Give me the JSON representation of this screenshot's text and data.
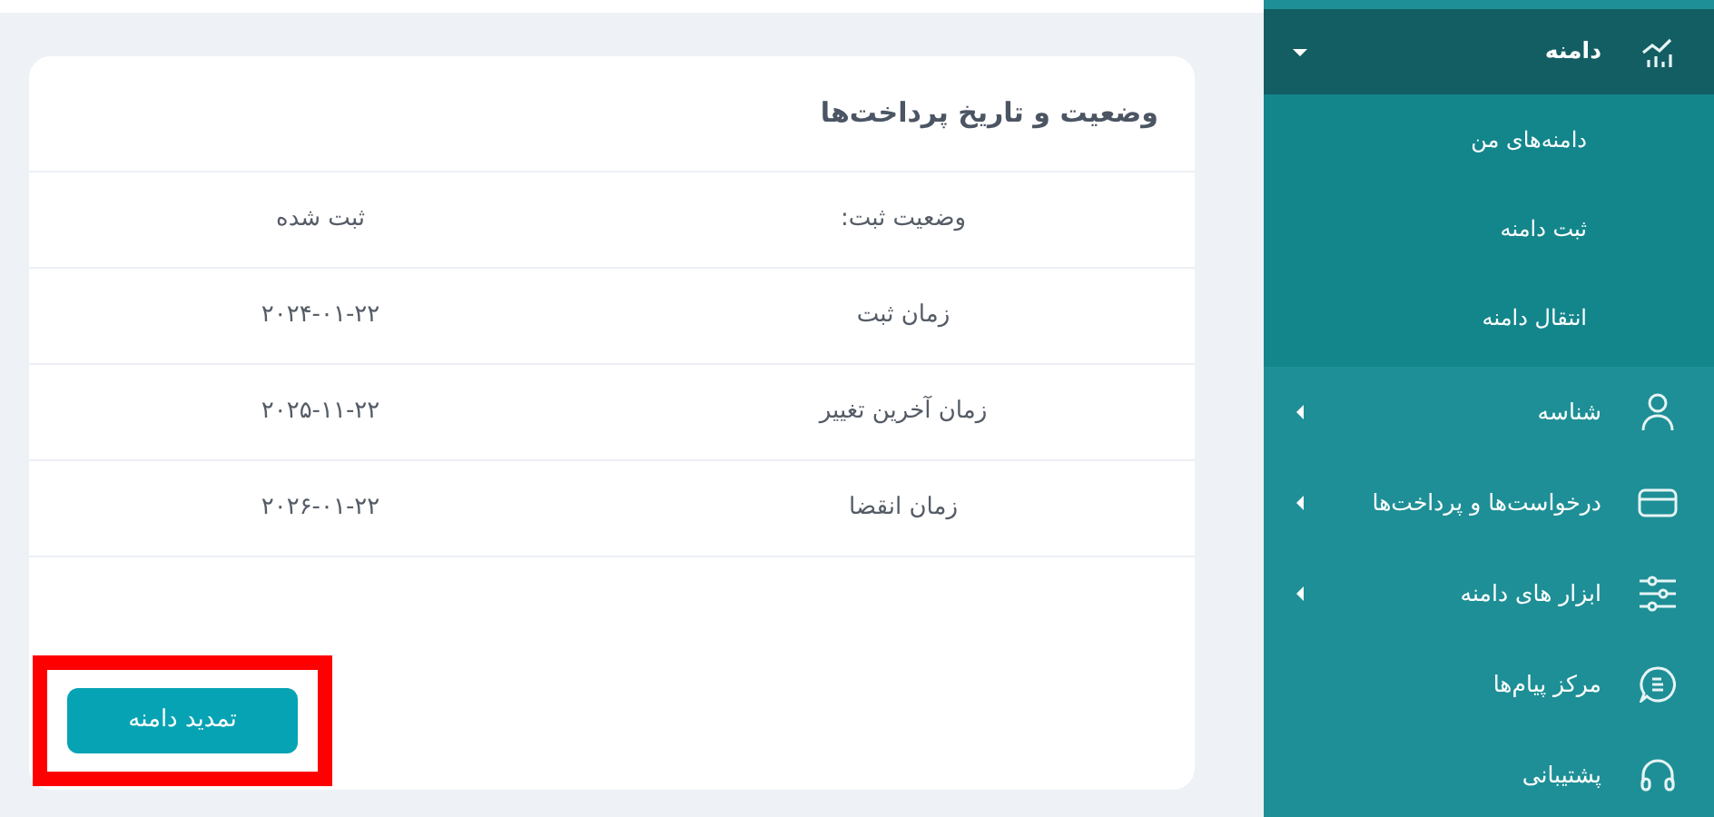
{
  "card": {
    "title": "وضعیت و تاریخ پرداخت‌ها",
    "rows": [
      {
        "label": "وضعیت ثبت:",
        "value": "ثبت شده"
      },
      {
        "label": "زمان ثبت",
        "value": "۲۰۲۴-۰۱-۲۲"
      },
      {
        "label": "زمان آخرین تغییر",
        "value": "۲۰۲۵-۱۱-۲۲"
      },
      {
        "label": "زمان انقضا",
        "value": "۲۰۲۶-۰۱-۲۲"
      }
    ],
    "button": {
      "label": "تمدید دامنه",
      "highlighted": true
    }
  },
  "sidebar": {
    "items": [
      {
        "label": "دامنه",
        "expanded": true,
        "children": [
          {
            "label": "دامنه‌های من"
          },
          {
            "label": "ثبت دامنه"
          },
          {
            "label": "انتقال دامنه"
          }
        ]
      },
      {
        "label": "شناسه",
        "expanded": false
      },
      {
        "label": "درخواست‌ها و پرداخت‌ها",
        "expanded": false
      },
      {
        "label": "ابزار های دامنه",
        "expanded": false
      },
      {
        "label": "مرکز پیام‌ها"
      },
      {
        "label": "پشتیبانی"
      }
    ]
  }
}
